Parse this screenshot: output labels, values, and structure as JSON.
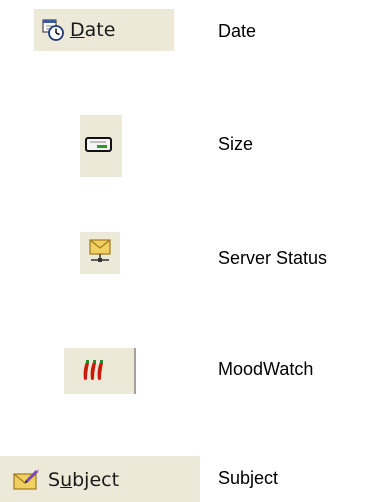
{
  "legend": {
    "items": [
      {
        "id": "date",
        "button_text_first": "D",
        "button_text_rest": "ate",
        "label": "Date",
        "icon": "clock-calendar-icon"
      },
      {
        "id": "size",
        "label": "Size",
        "icon": "hard-drive-icon"
      },
      {
        "id": "server_status",
        "label": "Server Status",
        "icon": "network-envelope-icon"
      },
      {
        "id": "moodwatch",
        "label": "MoodWatch",
        "icon": "chili-peppers-icon"
      },
      {
        "id": "subject",
        "button_text_first": "S",
        "button_text_underline": "u",
        "button_text_rest": "bject",
        "label": "Subject",
        "icon": "envelope-pencil-icon"
      }
    ]
  },
  "colors": {
    "button_face": "#ece9d8",
    "accent_green": "#2a9a2a",
    "pepper_red": "#cc1a0a",
    "envelope_yellow": "#f0d060"
  }
}
